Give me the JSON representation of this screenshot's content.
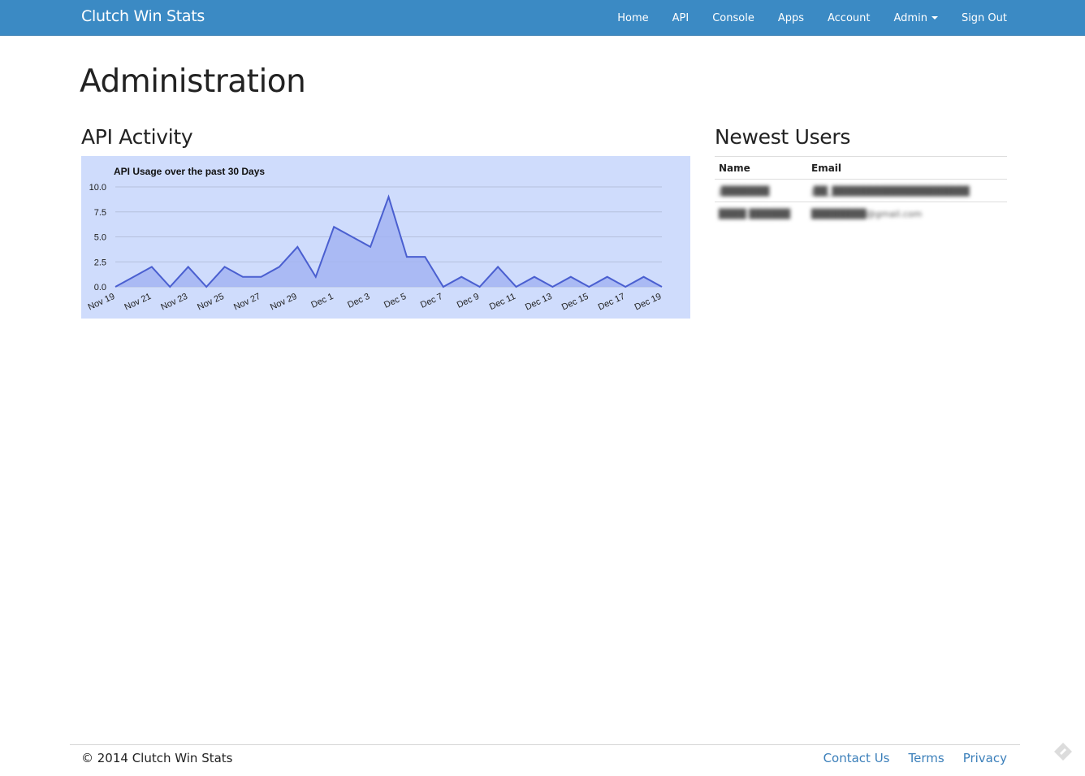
{
  "navbar": {
    "brand": "Clutch Win Stats",
    "links": [
      "Home",
      "API",
      "Console",
      "Apps",
      "Account",
      "Admin",
      "Sign Out"
    ]
  },
  "page": {
    "title": "Administration",
    "api_activity_title": "API Activity",
    "newest_users_title": "Newest Users"
  },
  "users": {
    "headers": [
      "Name",
      "Email"
    ],
    "rows": [
      {
        "name": "j███████",
        "email": "j██_████████████████████"
      },
      {
        "name": "████ ██████",
        "email": "████████@gmail.com"
      }
    ]
  },
  "footer": {
    "copyright": "© 2014 Clutch Win Stats",
    "links": [
      "Contact Us",
      "Terms",
      "Privacy"
    ]
  },
  "colors": {
    "navbar": "#3b8ac4",
    "chart_background": "#cfdcfc",
    "line": "#4a5fd0",
    "area": "#a3b4f2",
    "link": "#3b7fba"
  },
  "chart_data": {
    "type": "area",
    "title": "API Usage over the past 30 Days",
    "x": [
      "Nov 19",
      "Nov 20",
      "Nov 21",
      "Nov 22",
      "Nov 23",
      "Nov 24",
      "Nov 25",
      "Nov 26",
      "Nov 27",
      "Nov 28",
      "Nov 29",
      "Nov 30",
      "Dec 1",
      "Dec 2",
      "Dec 3",
      "Dec 4",
      "Dec 5",
      "Dec 6",
      "Dec 7",
      "Dec 8",
      "Dec 9",
      "Dec 10",
      "Dec 11",
      "Dec 12",
      "Dec 13",
      "Dec 14",
      "Dec 15",
      "Dec 16",
      "Dec 17",
      "Dec 18",
      "Dec 19"
    ],
    "x_tick_labels": [
      "Nov 19",
      "Nov 21",
      "Nov 23",
      "Nov 25",
      "Nov 27",
      "Nov 29",
      "Dec 1",
      "Dec 3",
      "Dec 5",
      "Dec 7",
      "Dec 9",
      "Dec 11",
      "Dec 13",
      "Dec 15",
      "Dec 17",
      "Dec 19"
    ],
    "values": [
      0,
      1,
      2,
      0,
      2,
      0,
      2,
      1,
      1,
      2,
      4,
      1,
      6,
      5,
      4,
      9,
      3,
      3,
      0,
      1,
      0,
      2,
      0,
      1,
      0,
      1,
      0,
      1,
      0,
      1,
      0
    ],
    "y_ticks": [
      "0.0",
      "2.5",
      "5.0",
      "7.5",
      "10.0"
    ],
    "ylim": [
      0,
      10
    ],
    "grid": true,
    "legend": "none"
  }
}
